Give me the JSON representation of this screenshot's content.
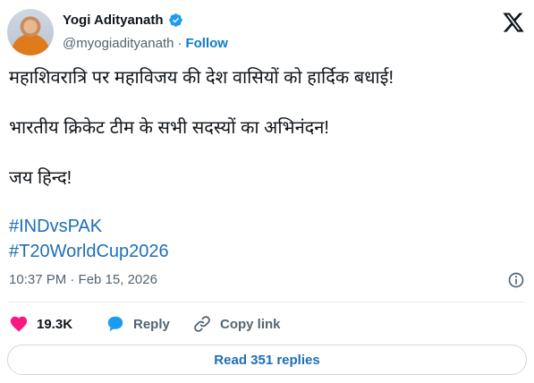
{
  "author": {
    "name": "Yogi Adityanath",
    "handle": "@myogiadityanath",
    "separator": "·",
    "follow_label": "Follow",
    "verified": true
  },
  "tweet": {
    "paragraphs": [
      "महाशिवरात्रि पर महाविजय की देश वासियों को हार्दिक बधाई!",
      "भारतीय क्रिकेट टीम के सभी सदस्यों का अभिनंदन!",
      "जय हिन्द!"
    ],
    "hashtags": [
      "#INDvsPAK",
      "#T20WorldCup2026"
    ],
    "timestamp": "10:37 PM · Feb 15, 2026"
  },
  "actions": {
    "like_count": "19.3K",
    "reply_label": "Reply",
    "copy_label": "Copy link"
  },
  "read_replies_label": "Read 351 replies",
  "colors": {
    "like": "#f91880",
    "reply": "#1d9bf0",
    "link": "#1d6fb8",
    "verified": "#1d9bf0"
  },
  "icons": [
    "verified-badge-icon",
    "x-logo-icon",
    "info-icon",
    "heart-icon",
    "reply-bubble-icon",
    "link-icon"
  ]
}
